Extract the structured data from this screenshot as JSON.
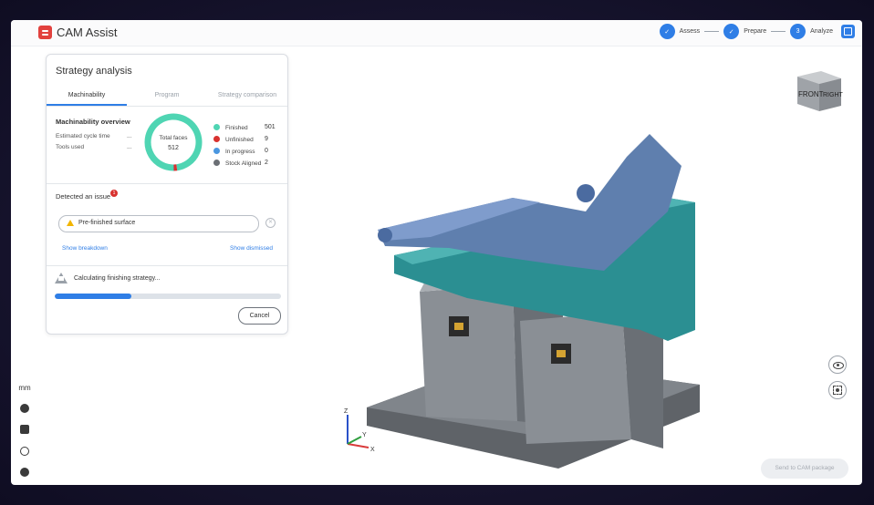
{
  "header": {
    "app_title": "CAM Assist",
    "steps": [
      {
        "label": "Assess",
        "marker": "✓"
      },
      {
        "label": "Prepare",
        "marker": "✓"
      },
      {
        "label": "Analyze",
        "marker": "3"
      }
    ]
  },
  "rail": {
    "units": "mm"
  },
  "panel": {
    "title": "Strategy analysis",
    "tabs": [
      "Machinability",
      "Program",
      "Strategy comparison"
    ],
    "overview": {
      "title": "Machinability overview",
      "rows": [
        {
          "label": "Estimated cycle time",
          "value": "..."
        },
        {
          "label": "Tools used",
          "value": "..."
        }
      ],
      "donut_label": "Total faces",
      "donut_total": "512"
    },
    "legend": [
      {
        "label": "Finished",
        "value": "501",
        "color": "#4fd5b3"
      },
      {
        "label": "Unfinished",
        "value": "9",
        "color": "#d8322f"
      },
      {
        "label": "In progress",
        "value": "0",
        "color": "#4a97e0"
      },
      {
        "label": "Stock Aligned",
        "value": "2",
        "color": "#6b6f75"
      }
    ],
    "issue": {
      "title": "Detected an issue",
      "badge": "1",
      "item": "Pre-finished surface",
      "show_breakdown": "Show breakdown",
      "show_dismissed": "Show dismissed"
    },
    "calc": {
      "text": "Calculating finishing strategy...",
      "progress": 0.34,
      "cancel": "Cancel"
    }
  },
  "viewport": {
    "cube_front": "FRONT",
    "cube_right": "RIGHT",
    "send_button": "Send to CAM package",
    "axis_z": "Z",
    "axis_y": "Y",
    "axis_x": "X"
  },
  "chart_data": {
    "type": "pie",
    "categories": [
      "Finished",
      "Unfinished",
      "In progress",
      "Stock Aligned"
    ],
    "values": [
      501,
      9,
      0,
      2
    ]
  }
}
